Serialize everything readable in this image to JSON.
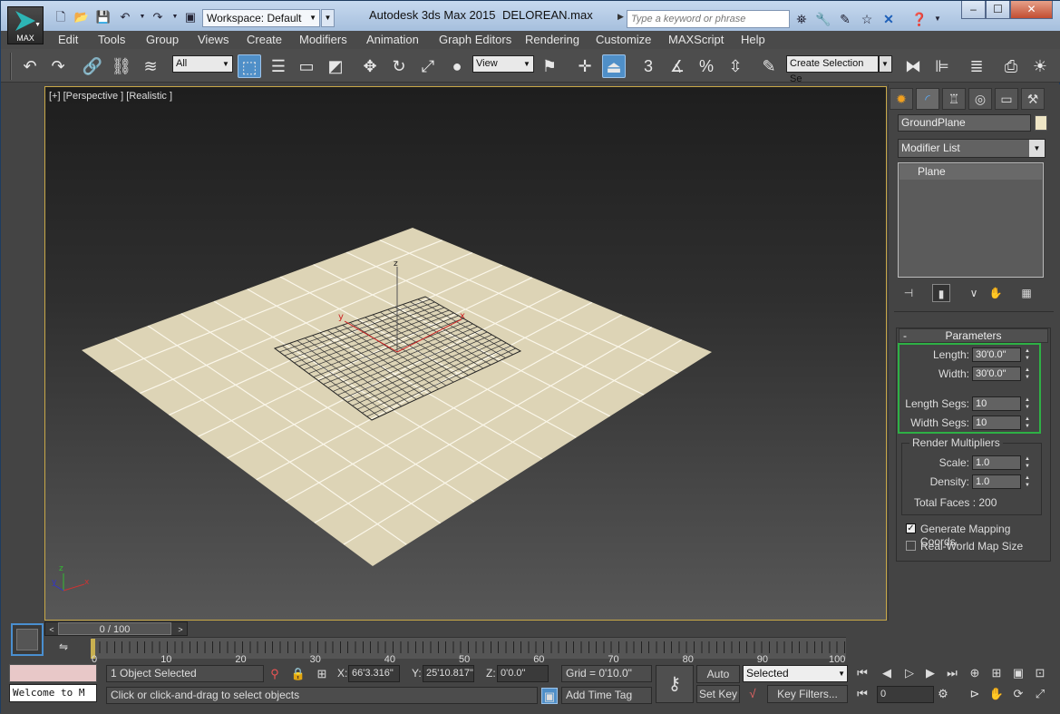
{
  "titlebar": {
    "app_name": "Autodesk 3ds Max  2015",
    "file_name": "DELOREAN.max",
    "workspace": "Workspace: Default",
    "search_placeholder": "Type a keyword or phrase",
    "logo_label": "MAX"
  },
  "menubar": [
    "Edit",
    "Tools",
    "Group",
    "Views",
    "Create",
    "Modifiers",
    "Animation",
    "Graph Editors",
    "Rendering",
    "Customize",
    "MAXScript",
    "Help"
  ],
  "toolbar": {
    "filter_value": "All",
    "refcoord_value": "View",
    "named_selection_placeholder": "Create Selection Se",
    "snap_label": "3",
    "percent_snap_label": "%"
  },
  "viewport": {
    "label": "[+] [Perspective ] [Realistic ]",
    "axis_x": "x",
    "axis_y": "y",
    "axis_z": "z"
  },
  "command_panel": {
    "object_name": "GroundPlane",
    "modifier_list": "Modifier List",
    "stack_items": [
      "Plane"
    ],
    "parameters_title": "Parameters",
    "collapse_symbol": "-",
    "length_label": "Length:",
    "length_value": "30'0.0\"",
    "width_label": "Width:",
    "width_value": "30'0.0\"",
    "length_segs_label": "Length Segs:",
    "length_segs_value": "10",
    "width_segs_label": "Width Segs:",
    "width_segs_value": "10",
    "render_multipliers_label": "Render Multipliers",
    "scale_label": "Scale:",
    "scale_value": "1.0",
    "density_label": "Density:",
    "density_value": "1.0",
    "total_faces": "Total Faces : 200",
    "gen_mapping_label": "Generate Mapping Coords.",
    "gen_mapping_checked": true,
    "realworld_label": "Real-World Map Size",
    "realworld_checked": false
  },
  "timeslider": {
    "position": "0 / 100",
    "ticks": [
      "0",
      "10",
      "20",
      "30",
      "40",
      "50",
      "60",
      "70",
      "80",
      "90",
      "100"
    ]
  },
  "status": {
    "selection": "1 Object Selected",
    "prompt": "Click or click-and-drag to select objects",
    "welcome": "Welcome to M",
    "x_label": "X:",
    "x_value": "66'3.316\"",
    "y_label": "Y:",
    "y_value": "25'10.817\"",
    "z_label": "Z:",
    "z_value": "0'0.0\"",
    "grid": "Grid = 0'10.0\"",
    "add_time_tag": "Add Time Tag",
    "auto_key": "Auto Key",
    "set_key": "Set Key",
    "key_mode": "Selected",
    "key_filters": "Key Filters...",
    "frame": "0"
  }
}
